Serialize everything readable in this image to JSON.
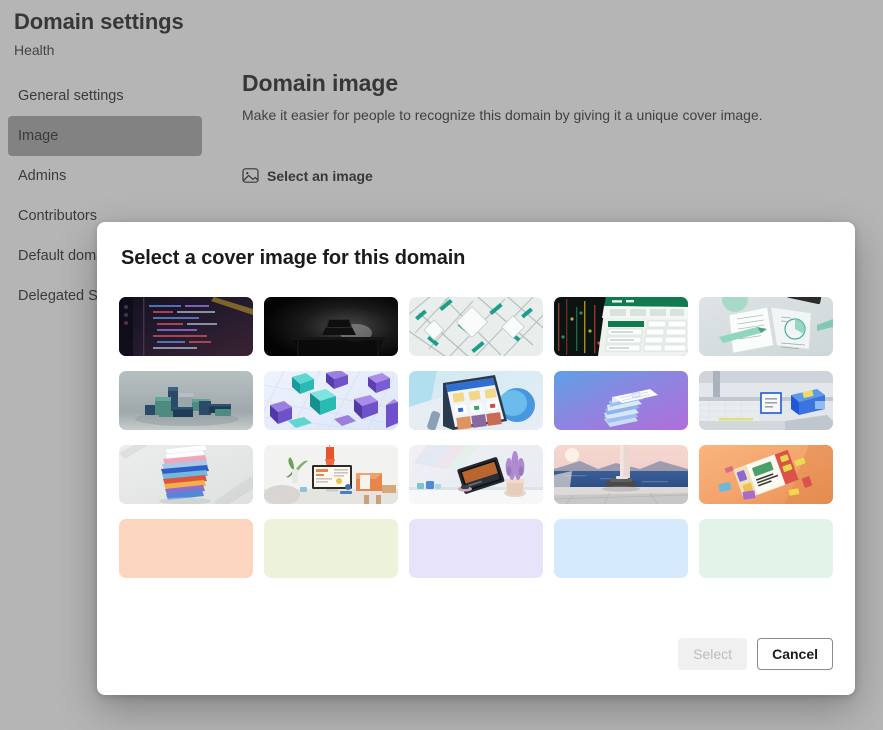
{
  "page": {
    "title": "Domain settings",
    "subtitle": "Health"
  },
  "sidebar": {
    "items": [
      {
        "label": "General settings",
        "selected": false
      },
      {
        "label": "Image",
        "selected": true
      },
      {
        "label": "Admins",
        "selected": false
      },
      {
        "label": "Contributors",
        "selected": false
      },
      {
        "label": "Default domain image",
        "selected": false
      },
      {
        "label": "Delegated Settings",
        "selected": false
      }
    ]
  },
  "main": {
    "heading": "Domain image",
    "description": "Make it easier for people to recognize this domain by giving it a unique cover image.",
    "select_image_label": "Select an image",
    "select_image_icon": "image-icon"
  },
  "dialog": {
    "title": "Select a cover image for this domain",
    "select_button": "Select",
    "select_button_disabled": true,
    "cancel_button": "Cancel",
    "thumbnails": [
      {
        "id": "code-editor-dark",
        "name": "dark-code-editor-screen",
        "kind": "photo",
        "colors": [
          "#1c1a2b",
          "#3a2f4a",
          "#c9a227"
        ]
      },
      {
        "id": "laptop-dark-desk",
        "name": "laptop-on-dark-desk",
        "kind": "photo",
        "colors": [
          "#050505",
          "#1d1d1d",
          "#9a9a9a"
        ]
      },
      {
        "id": "abstract-teal-circuit",
        "name": "abstract-teal-circuit-board",
        "kind": "photo",
        "colors": [
          "#e8ece9",
          "#0f9b87",
          "#b9c2c0"
        ]
      },
      {
        "id": "spreadsheet-dark",
        "name": "spreadsheet-on-dark-screen",
        "kind": "photo",
        "colors": [
          "#0c1410",
          "#117a4e",
          "#d7ece0"
        ]
      },
      {
        "id": "open-notebook",
        "name": "open-notebook-with-charts",
        "kind": "photo",
        "colors": [
          "#d7dde0",
          "#8fd6bd",
          "#f3f5f6"
        ]
      },
      {
        "id": "teal-blocks",
        "name": "teal-3d-blocks",
        "kind": "photo",
        "colors": [
          "#a9b4b4",
          "#3f7d79",
          "#22405e"
        ]
      },
      {
        "id": "purple-crystals",
        "name": "purple-teal-crystal-cubes",
        "kind": "photo",
        "colors": [
          "#e3ecfa",
          "#7a5fd0",
          "#2ec7c0"
        ]
      },
      {
        "id": "phone-app",
        "name": "phone-with-app-screen",
        "kind": "photo",
        "colors": [
          "#bfe4ef",
          "#2b5fd0",
          "#e9edf2"
        ]
      },
      {
        "id": "stacked-cards-purple",
        "name": "stacked-cards-on-gradient",
        "kind": "photo",
        "colors": [
          "#6fa8e8",
          "#a06ee0",
          "#ffffff"
        ]
      },
      {
        "id": "printer-office",
        "name": "office-printer-scene",
        "kind": "photo",
        "colors": [
          "#dfe2e6",
          "#2257d6",
          "#9aa3ad"
        ]
      },
      {
        "id": "paper-stack",
        "name": "colorful-paper-stack",
        "kind": "photo",
        "colors": [
          "#e6e6e6",
          "#2f5fc4",
          "#e2533c"
        ]
      },
      {
        "id": "desk-monitor-plant",
        "name": "desk-with-monitor-and-plant",
        "kind": "photo",
        "colors": [
          "#efefef",
          "#e8552c",
          "#6aa05a"
        ]
      },
      {
        "id": "tablet-lavender",
        "name": "tablet-with-lavender-plant",
        "kind": "photo",
        "colors": [
          "#eef0f3",
          "#b08ad0",
          "#3f6fa8"
        ]
      },
      {
        "id": "lake-sunrise",
        "name": "lake-at-sunrise-terrace",
        "kind": "photo",
        "colors": [
          "#f0c8c2",
          "#2b4f86",
          "#d9e2ea"
        ]
      },
      {
        "id": "orange-tablet-flat",
        "name": "orange-flatlay-tablet",
        "kind": "photo",
        "colors": [
          "#f5a86a",
          "#6d4bd0",
          "#f2e6c8"
        ]
      },
      {
        "id": "solid-peach",
        "name": "solid-peach-swatch",
        "kind": "solid",
        "colors": [
          "#fbd5c0"
        ]
      },
      {
        "id": "solid-lime",
        "name": "solid-lime-swatch",
        "kind": "solid",
        "colors": [
          "#edf2da"
        ]
      },
      {
        "id": "solid-lavender",
        "name": "solid-lavender-swatch",
        "kind": "solid",
        "colors": [
          "#e6e3fb"
        ]
      },
      {
        "id": "solid-sky",
        "name": "solid-sky-blue-swatch",
        "kind": "solid",
        "colors": [
          "#d6eafd"
        ]
      },
      {
        "id": "solid-mint",
        "name": "solid-mint-swatch",
        "kind": "solid",
        "colors": [
          "#e2f3ea"
        ]
      }
    ]
  },
  "colors": {
    "scrim": "#b0b0b0",
    "accent_selected_nav": "#a3a3a3",
    "dialog_bg": "#ffffff",
    "text_primary": "#1b1b1b"
  }
}
